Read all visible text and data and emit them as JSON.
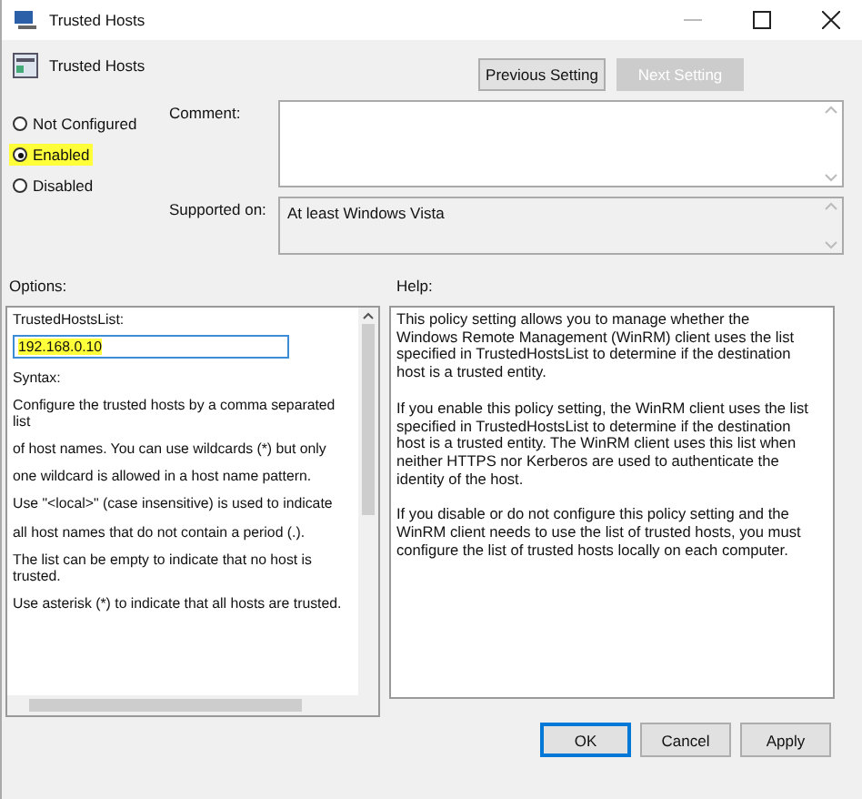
{
  "window": {
    "title": "Trusted Hosts"
  },
  "header": {
    "title": "Trusted Hosts",
    "buttons": [
      {
        "label": "Previous Setting",
        "disabled": false
      },
      {
        "label": "Next Setting",
        "disabled": true
      }
    ]
  },
  "state_options": [
    {
      "label": "Not Configured",
      "selected": false,
      "highlighted": false
    },
    {
      "label": "Enabled",
      "selected": true,
      "highlighted": true
    },
    {
      "label": "Disabled",
      "selected": false,
      "highlighted": false
    }
  ],
  "comment": {
    "label": "Comment:"
  },
  "supported_on": {
    "label": "Supported on:",
    "value": "At least Windows Vista"
  },
  "options": {
    "label": "Options:",
    "field_label": "TrustedHostsList:",
    "field_value": "192.168.0.10",
    "field_highlighted": true,
    "lines": [
      "Syntax:",
      "Configure the trusted hosts by a comma separated list",
      "of host names. You can use wildcards (*) but only",
      "one wildcard is allowed in a host name pattern.",
      "Use \"<local>\" (case insensitive) is used to indicate",
      "all host names that do not contain a period (.).",
      "The list can be empty to indicate that no host is trusted.",
      "Use asterisk (*)  to indicate that all hosts are trusted."
    ]
  },
  "help": {
    "label": "Help:",
    "paragraphs": [
      "This policy setting allows you to manage whether the Windows Remote Management (WinRM) client uses the list specified in TrustedHostsList to determine if the destination host is a trusted entity.",
      "If you enable this policy setting, the WinRM client uses the list specified in TrustedHostsList to determine if the destination host is a trusted entity. The WinRM client uses this list when neither HTTPS nor Kerberos are used to authenticate the identity of the host.",
      "If you disable or do not configure this policy setting and the WinRM client needs to use the list of trusted hosts, you must configure the list of trusted hosts locally on each computer."
    ]
  },
  "footer_buttons": [
    {
      "label": "OK",
      "default": true
    },
    {
      "label": "Cancel",
      "default": false
    },
    {
      "label": "Apply",
      "default": false
    }
  ]
}
